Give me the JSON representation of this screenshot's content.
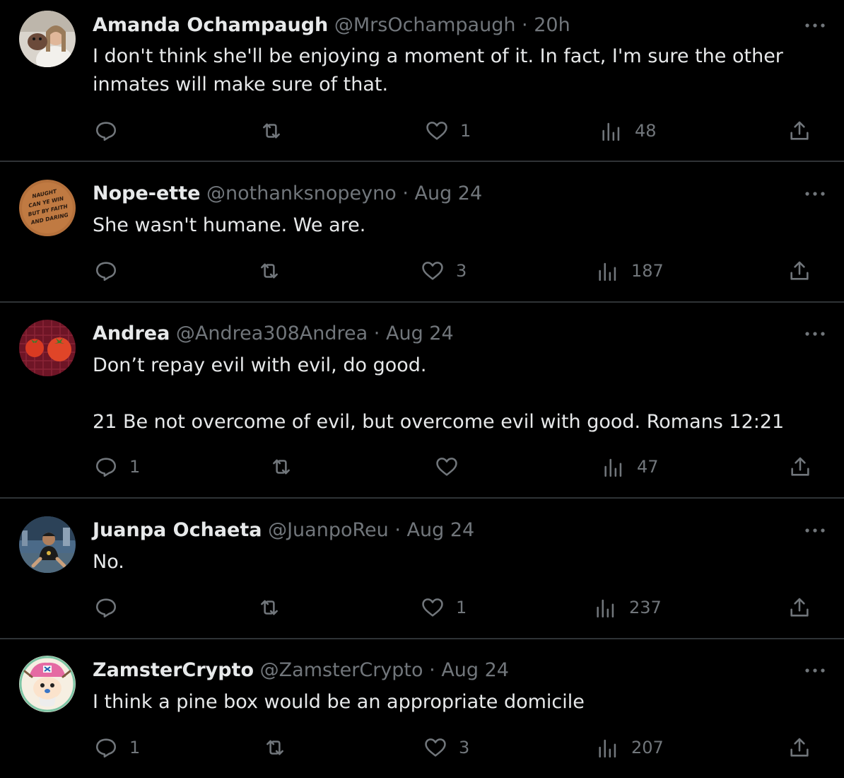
{
  "replies": [
    {
      "name": "Amanda Ochampaugh",
      "handle": "@MrsOchampaugh",
      "separator": "·",
      "time": "20h",
      "text": [
        "I don't think she'll be enjoying a moment of it. In fact, I'm sure the other inmates will make sure of that."
      ],
      "replies_count": "",
      "likes": "1",
      "views": "48",
      "avatar_icon": "avatar-woman-with-dog-icon"
    },
    {
      "name": "Nope-ette",
      "handle": "@nothanksnopeyno",
      "separator": "·",
      "time": "Aug 24",
      "text": [
        "She wasn't humane. We are."
      ],
      "replies_count": "",
      "likes": "3",
      "views": "187",
      "avatar_icon": "avatar-stamp-icon",
      "avatar_text": [
        "NAUGHT",
        "CAN YE WIN",
        "BUT BY FAITH",
        "AND DARING"
      ]
    },
    {
      "name": "Andrea",
      "handle": "@Andrea308Andrea",
      "separator": "·",
      "time": "Aug 24",
      "text": [
        "Don’t repay evil with evil, do good.",
        "21 Be not overcome of evil, but overcome evil with good. Romans 12:21"
      ],
      "replies_count": "1",
      "likes": "",
      "views": "47",
      "avatar_icon": "avatar-tomatoes-icon"
    },
    {
      "name": "Juanpa Ochaeta",
      "handle": "@JuanpoReu",
      "separator": "·",
      "time": "Aug 24",
      "text": [
        "No."
      ],
      "replies_count": "",
      "likes": "1",
      "views": "237",
      "avatar_icon": "avatar-man-city-icon"
    },
    {
      "name": "ZamsterCrypto",
      "handle": "@ZamsterCrypto",
      "separator": "·",
      "time": "Aug 24",
      "text": [
        "I think a pine box would be an appropriate domicile"
      ],
      "replies_count": "1",
      "likes": "3",
      "views": "207",
      "avatar_icon": "avatar-cartoon-character-icon"
    }
  ],
  "icons": {
    "more": "more-dots-icon",
    "reply": "reply-bubble-icon",
    "retweet": "retweet-icon",
    "like": "heart-icon",
    "views": "views-bars-icon",
    "share": "share-icon"
  },
  "colors": {
    "background": "#000000",
    "text": "#e7e9ea",
    "muted": "#71767b",
    "divider": "#2f3336"
  }
}
